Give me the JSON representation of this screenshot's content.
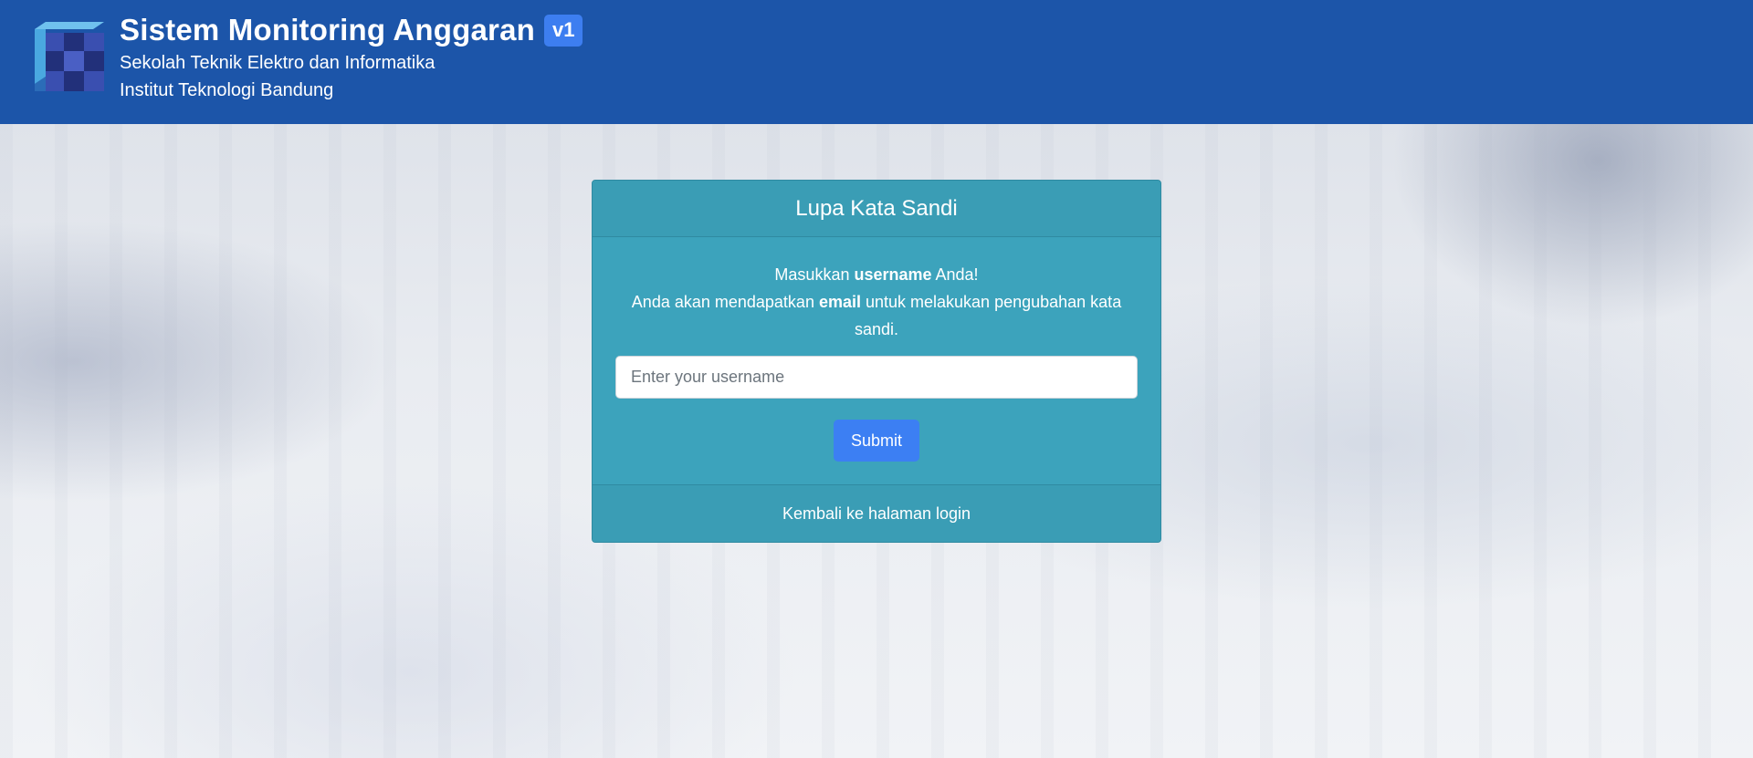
{
  "header": {
    "title": "Sistem Monitoring Anggaran",
    "version": "v1",
    "subtitle_line1": "Sekolah Teknik Elektro dan Informatika",
    "subtitle_line2": "Institut Teknologi Bandung",
    "logo_icon": "stei-cube-logo-icon"
  },
  "card": {
    "title": "Lupa Kata Sandi",
    "instruction_line1_prefix": "Masukkan ",
    "instruction_line1_bold": "username",
    "instruction_line1_suffix": " Anda!",
    "instruction_line2_prefix": "Anda akan mendapatkan ",
    "instruction_line2_bold": "email",
    "instruction_line2_suffix": " untuk melakukan pengubahan kata sandi.",
    "username_placeholder": "Enter your username",
    "username_value": "",
    "submit_label": "Submit",
    "back_link": "Kembali ke halaman login"
  },
  "colors": {
    "header_bg": "#1c55a9",
    "badge_bg": "#3d7ef0",
    "card_bg": "#3ca3bc",
    "submit_bg": "#3c7ff3"
  }
}
